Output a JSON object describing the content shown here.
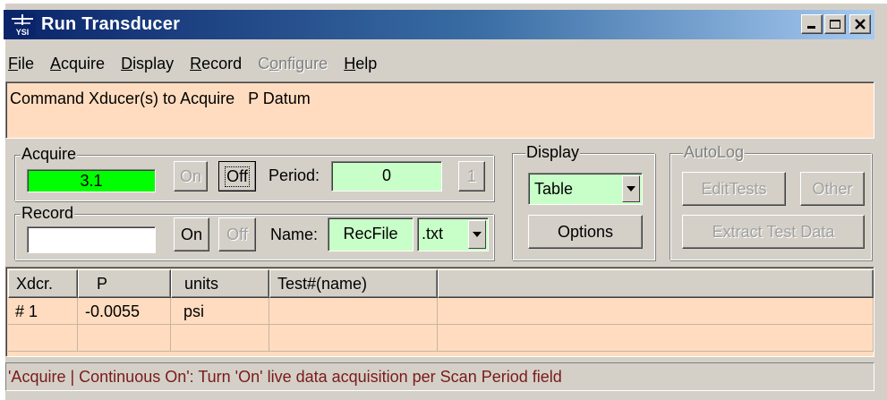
{
  "window": {
    "title": "Run Transducer",
    "app_icon_text": "YSI",
    "controls": {
      "minimize": "minimize-icon",
      "maximize": "maximize-icon",
      "close": "close-icon"
    }
  },
  "menu": [
    {
      "pre": "",
      "ul": "F",
      "post": "ile",
      "disabled": false
    },
    {
      "pre": "",
      "ul": "A",
      "post": "cquire",
      "disabled": false
    },
    {
      "pre": "",
      "ul": "D",
      "post": "isplay",
      "disabled": false
    },
    {
      "pre": "",
      "ul": "R",
      "post": "ecord",
      "disabled": false
    },
    {
      "pre": "C",
      "ul": "o",
      "post": "nfigure",
      "disabled": true
    },
    {
      "pre": "",
      "ul": "H",
      "post": "elp",
      "disabled": false
    }
  ],
  "command_text": "Command Xducer(s) to Acquire   P Datum",
  "acquire": {
    "label": "Acquire",
    "value": "3.1",
    "on_label": "On",
    "off_label": "Off",
    "period_label": "Period:",
    "period_value": "0",
    "step_label": "1"
  },
  "record": {
    "label": "Record",
    "value": "",
    "on_label": "On",
    "off_label": "Off",
    "name_label": "Name:",
    "name_value": "RecFile",
    "ext_value": ".txt"
  },
  "display": {
    "label": "Display",
    "selected": "Table",
    "options_label": "Options"
  },
  "autolog": {
    "label": "AutoLog",
    "edit_tests_label": "EditTests",
    "other_label": "Other",
    "extract_label": "Extract Test Data"
  },
  "table": {
    "columns": [
      "Xdcr.",
      "P",
      "units",
      "Test#(name)"
    ],
    "rows": [
      [
        "# 1",
        "-0.0055",
        "psi",
        ""
      ],
      [
        "",
        "",
        "",
        ""
      ]
    ]
  },
  "status_text": "'Acquire | Continuous On': Turn 'On' live data acquisition per Scan Period field",
  "colors": {
    "panel_bg": "#ffdcc0",
    "acquire_value_bg": "#00ff00",
    "input_green": "#c8ffc8",
    "status_text": "#7a1a1a"
  }
}
